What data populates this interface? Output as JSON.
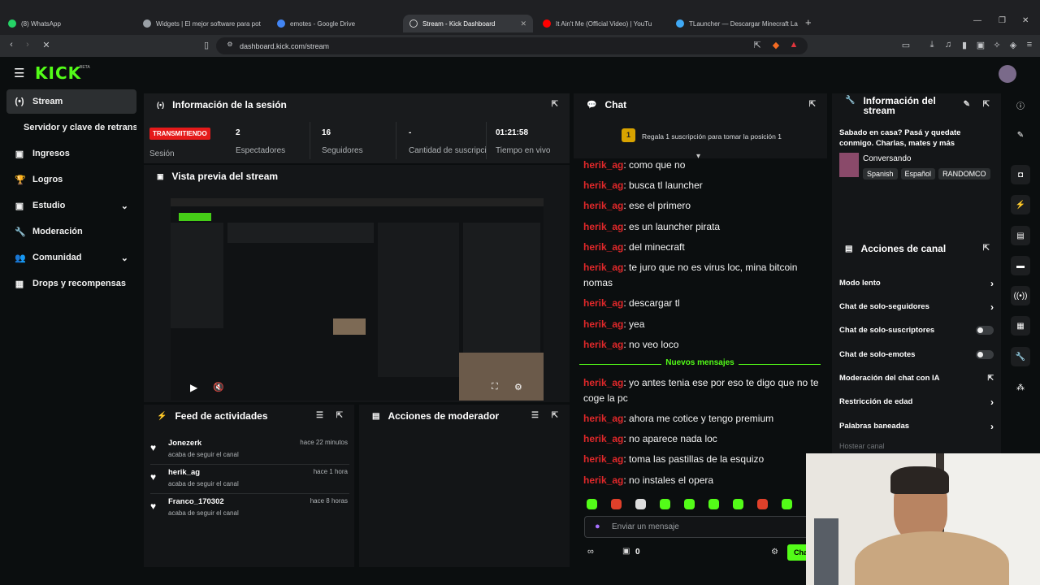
{
  "browser": {
    "tabs": [
      {
        "label": "(8) WhatsApp",
        "color": "#25d366"
      },
      {
        "label": "Widgets | El mejor software para pot",
        "color": "#9aa0a6"
      },
      {
        "label": "emotes - Google Drive",
        "color": "#4285f4"
      },
      {
        "label": "Stream - Kick Dashboard",
        "color": "#cccccc"
      },
      {
        "label": "It Ain't Me (Official Video) | YouTu",
        "color": "#ff0000"
      },
      {
        "label": "TLauncher — Descargar Minecraft La",
        "color": "#3fa9f5"
      }
    ],
    "url": "dashboard.kick.com/stream",
    "new_tab": "+"
  },
  "brand": {
    "logo": "KICK",
    "beta": "BETA"
  },
  "sidebar": {
    "items": [
      {
        "label": "Stream",
        "icon": "(•)"
      },
      {
        "label": "Servidor y clave de retransmisión",
        "icon": ""
      },
      {
        "label": "Ingresos",
        "icon": "▣"
      },
      {
        "label": "Logros",
        "icon": "🏆"
      },
      {
        "label": "Estudio",
        "icon": "▣"
      },
      {
        "label": "Moderación",
        "icon": "🔧"
      },
      {
        "label": "Comunidad",
        "icon": "👥"
      },
      {
        "label": "Drops y recompensas",
        "icon": "▦"
      }
    ]
  },
  "session": {
    "title": "Información de la sesión",
    "status": "TRANSMITIENDO",
    "status_label": "Sesión",
    "stats": [
      {
        "value": "2",
        "label": "Espectadores"
      },
      {
        "value": "16",
        "label": "Seguidores"
      },
      {
        "value": "-",
        "label": "Cantidad de suscripciones"
      },
      {
        "value": "01:21:58",
        "label": "Tiempo en vivo"
      }
    ]
  },
  "preview": {
    "title": "Vista previa del stream"
  },
  "feed": {
    "title": "Feed de actividades",
    "items": [
      {
        "name": "Jonezerk",
        "sub": "acaba de seguir el canal",
        "time": "hace 22 minutos"
      },
      {
        "name": "herik_ag",
        "sub": "acaba de seguir el canal",
        "time": "hace 1 hora"
      },
      {
        "name": "Franco_170302",
        "sub": "acaba de seguir el canal",
        "time": "hace 8 horas"
      }
    ]
  },
  "modactions": {
    "title": "Acciones de moderador"
  },
  "chat": {
    "title": "Chat",
    "gift_rank": "1",
    "gift_text": "Regala 1 suscripción para tomar la posición 1",
    "messages": [
      {
        "user": "herik_ag",
        "text": ": como que no"
      },
      {
        "user": "herik_ag",
        "text": ": busca tl launcher"
      },
      {
        "user": "herik_ag",
        "text": ": ese el primero"
      },
      {
        "user": "herik_ag",
        "text": ": es un launcher pirata"
      },
      {
        "user": "herik_ag",
        "text": ": del minecraft"
      },
      {
        "user": "herik_ag",
        "text": ": te juro que no es virus loc, mina bitcoin nomas"
      },
      {
        "user": "herik_ag",
        "text": ": descargar tl"
      },
      {
        "user": "herik_ag",
        "text": ": yea"
      },
      {
        "user": "herik_ag",
        "text": ": no veo loco"
      }
    ],
    "new_label": "Nuevos mensajes",
    "messages2": [
      {
        "user": "herik_ag",
        "text": ": yo antes tenia ese por eso te digo que no te coge la pc"
      },
      {
        "user": "herik_ag",
        "text": ": ahora me cotice y tengo premium"
      },
      {
        "user": "herik_ag",
        "text": ": no aparece nada loc"
      },
      {
        "user": "herik_ag",
        "text": ": toma las pastillas de la esquizo"
      },
      {
        "user": "herik_ag",
        "text": ": no instales el opera"
      }
    ],
    "placeholder": "Enviar un mensaje",
    "points": "0",
    "send": "Chat"
  },
  "streaminfo": {
    "title": "Información del stream",
    "desc": "Sabado en casa? Pasá y quedate conmigo. Charlas, mates y más",
    "category": "Conversando",
    "tags": [
      "Spanish",
      "Español",
      "RANDOMCO"
    ]
  },
  "channel": {
    "title": "Acciones de canal",
    "options": [
      {
        "label": "Modo lento",
        "control": "arrow"
      },
      {
        "label": "Chat de solo-seguidores",
        "control": "arrow"
      },
      {
        "label": "Chat de solo-suscriptores",
        "control": "toggle"
      },
      {
        "label": "Chat de solo-emotes",
        "control": "toggle"
      },
      {
        "label": "Moderación del chat con IA",
        "control": "link"
      },
      {
        "label": "Restricción de edad",
        "control": "arrow"
      },
      {
        "label": "Palabras baneadas",
        "control": "arrow"
      }
    ],
    "host": "Hostear canal"
  },
  "colors": {
    "accent": "#53fc18",
    "live": "#e51a1a",
    "username": "#e0282a"
  }
}
